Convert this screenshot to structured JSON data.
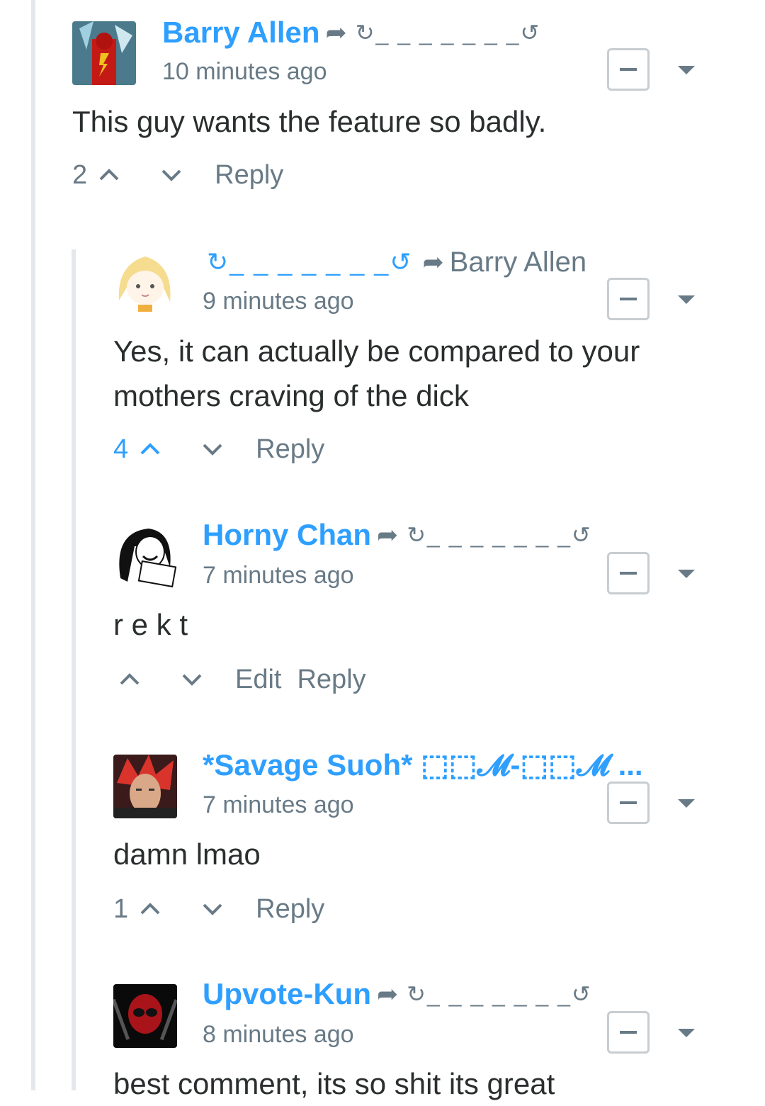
{
  "comments": [
    {
      "author": "Barry Allen",
      "author_suffix": "↻_ _ _ _ _ _ _↺",
      "time": "10 minutes ago",
      "text": "This guy wants the feature so badly.",
      "votes": "2",
      "actions": [
        "Reply"
      ]
    },
    {
      "author": "↻_ _ _ _ _ _ _↺",
      "reply_to": "Barry Allen",
      "time": "9 minutes ago",
      "text": "Yes, it can actually be compared to your mothers craving of the dick",
      "votes": "4",
      "actions": [
        "Reply"
      ]
    },
    {
      "author": "Horny Chan",
      "author_suffix": "↻_ _ _ _ _ _ _↺",
      "time": "7 minutes ago",
      "text": "r e k t",
      "votes": "",
      "actions": [
        "Edit",
        "Reply"
      ]
    },
    {
      "author": "*Savage Suoh* ⬚⬚𝓜-⬚⬚𝓜 ...",
      "time": "7 minutes ago",
      "text": "damn lmao",
      "votes": "1",
      "actions": [
        "Reply"
      ]
    },
    {
      "author": "Upvote-Kun",
      "author_suffix": "↻_ _ _ _ _ _ _↺",
      "time": "8 minutes ago",
      "text": "best comment, its so shit its great",
      "votes": "",
      "actions": []
    }
  ],
  "icons": {
    "share": "share-arrow-icon",
    "collapse": "minus-icon",
    "menu": "caret-down-icon",
    "upvote": "chevron-up-icon",
    "downvote": "chevron-down-icon"
  },
  "colors": {
    "accent": "#2e9fff",
    "muted": "#687a86",
    "text": "#2a2e2e",
    "line": "#e4e7eb"
  }
}
